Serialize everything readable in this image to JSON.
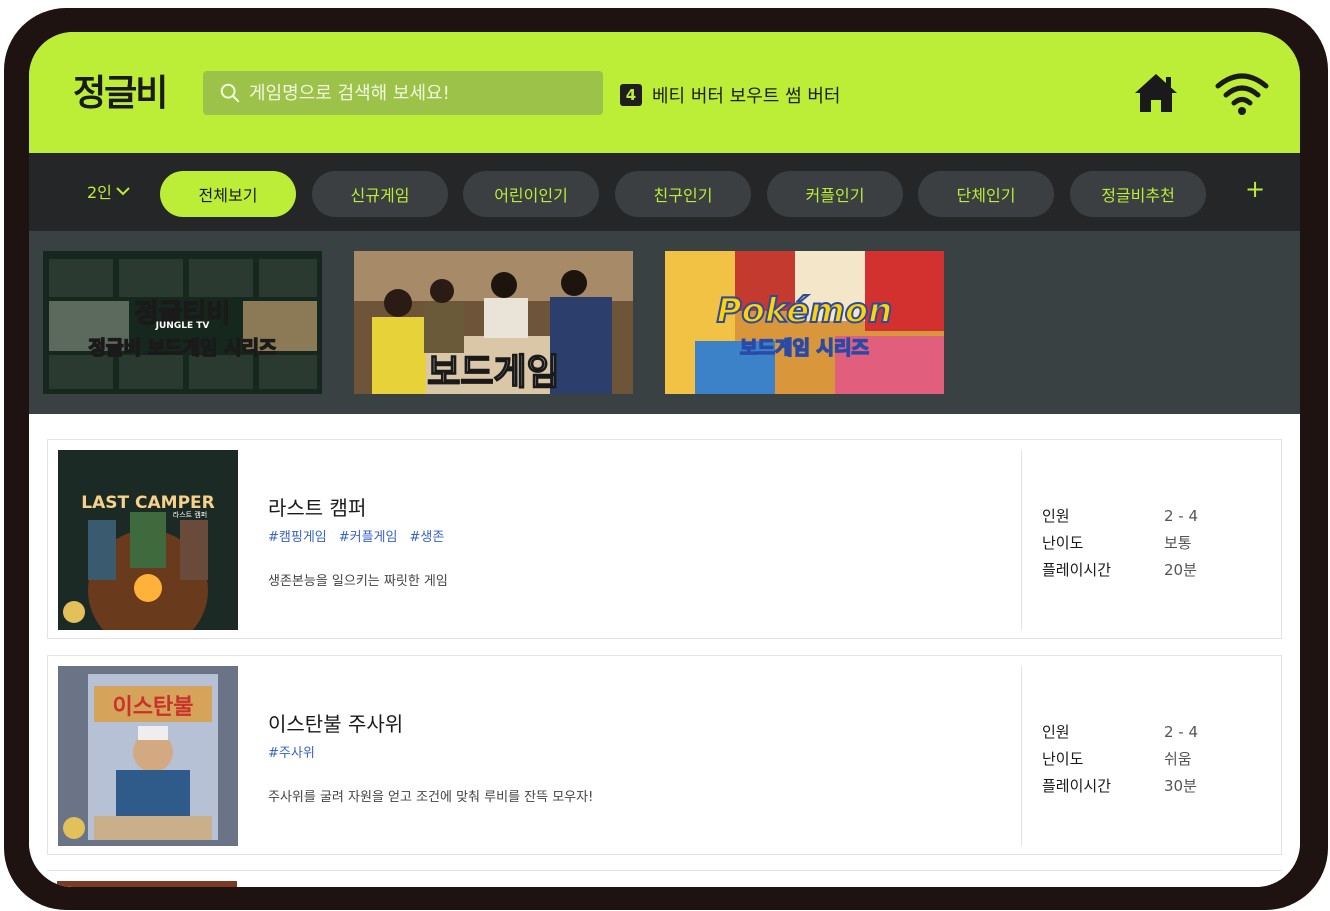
{
  "header": {
    "logo": "정글비",
    "search_placeholder": "게임명으로 검색해 보세요!",
    "ranking": {
      "rank": "4",
      "text": "베티 버터 보우트 썸 버터"
    }
  },
  "nav": {
    "people": "2인",
    "tabs": [
      "전체보기",
      "신규게임",
      "어린이인기",
      "친구인기",
      "커플인기",
      "단체인기",
      "정글비추천"
    ],
    "active_tab": "전체보기",
    "more": "+"
  },
  "banners": [
    {
      "title": "정글티비",
      "subtitle": "JUNGLE TV",
      "caption": "정글비 보드게임 시리즈"
    },
    {
      "title": "보드게임"
    },
    {
      "title": "Pokémon",
      "caption": "보드게임 시리즈"
    }
  ],
  "games": [
    {
      "title": "라스트 캠퍼",
      "cover_text": "LAST CAMPER",
      "cover_subtext": "라스트 캠퍼",
      "tags": [
        "#캠핑게임",
        "#커플게임",
        "#생존"
      ],
      "description": "생존본능을 일으키는 짜릿한 게임",
      "specs": [
        {
          "label": "인원",
          "value": "2 - 4"
        },
        {
          "label": "난이도",
          "value": "보통"
        },
        {
          "label": "플레이시간",
          "value": "20분"
        }
      ]
    },
    {
      "title": "이스탄불 주사위",
      "cover_text": "이스탄불",
      "tags": [
        "#주사위"
      ],
      "description": "주사위를 굴려 자원을 얻고 조건에 맞춰 루비를 잔뜩 모우자!",
      "specs": [
        {
          "label": "인원",
          "value": "2 - 4"
        },
        {
          "label": "난이도",
          "value": "쉬움"
        },
        {
          "label": "플레이시간",
          "value": "30분"
        }
      ]
    }
  ],
  "colors": {
    "accent": "#bced37",
    "nav_bg": "#252627",
    "banner_bg": "#3a4143",
    "tag": "#3563c9",
    "frame": "#1e1310"
  }
}
